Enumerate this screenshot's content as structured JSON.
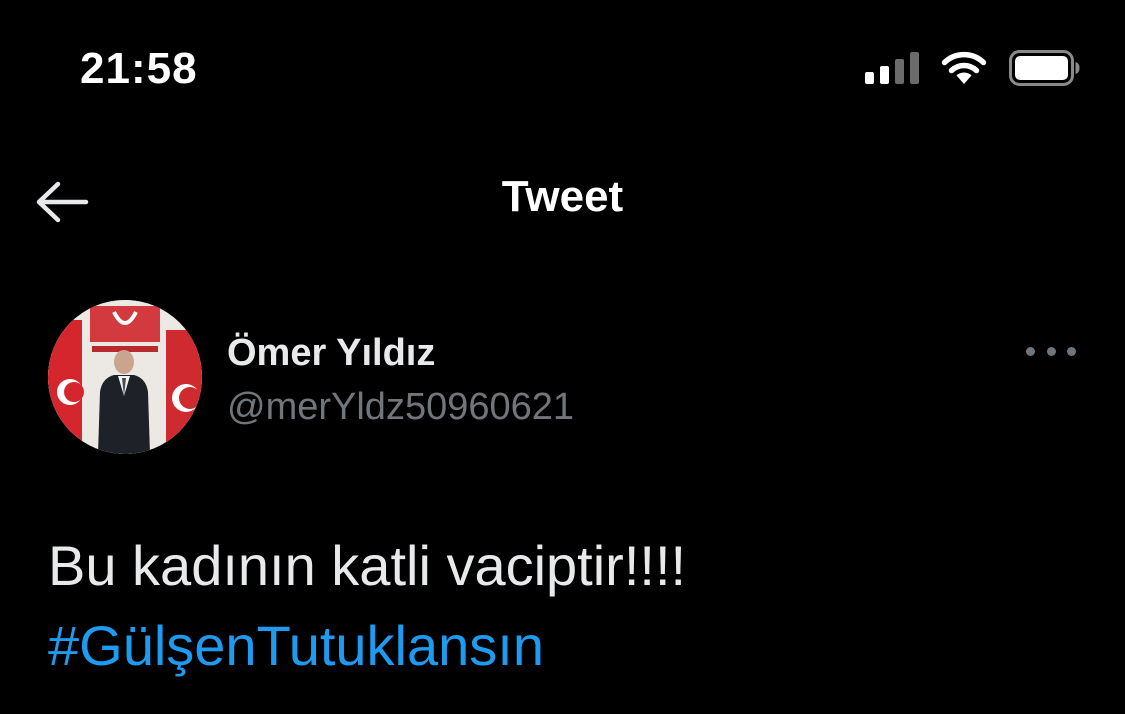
{
  "status_bar": {
    "time": "21:58",
    "signal_icon": "cellular-signal-icon",
    "wifi_icon": "wifi-icon",
    "battery_icon": "battery-icon"
  },
  "nav": {
    "title": "Tweet",
    "back_icon": "arrow-left-icon"
  },
  "tweet": {
    "author_name": "Ömer Yıldız",
    "author_handle": "@merYldz50960621",
    "text": "Bu kadının katli vaciptir!!!!",
    "hashtag": "#GülşenTutuklansın",
    "more_icon": "more-horizontal-icon"
  },
  "colors": {
    "background": "#000000",
    "primary_text": "#e7e9ea",
    "secondary_text": "#71767b",
    "link": "#1d9bf0"
  }
}
